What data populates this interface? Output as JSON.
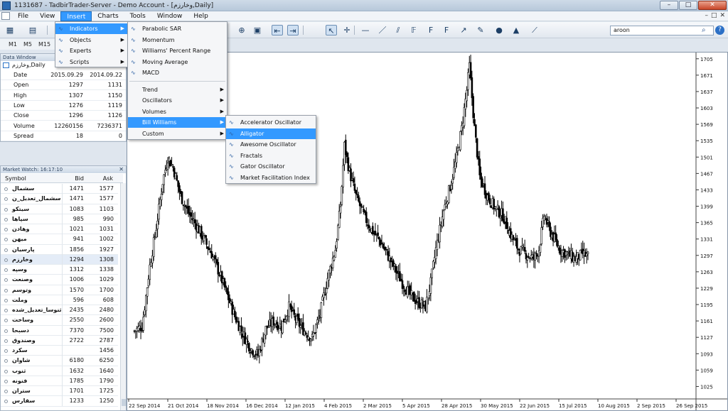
{
  "window": {
    "title": "1131687 - TadbirTrader-Server - Demo Account - [وخارزم,Daily]",
    "controls": [
      "–",
      "□",
      "✕"
    ]
  },
  "menubar": {
    "items": [
      "File",
      "View",
      "Insert",
      "Charts",
      "Tools",
      "Window",
      "Help"
    ],
    "active": "Insert",
    "mdi_controls": [
      "–",
      "□",
      "✕"
    ]
  },
  "toolbar": {
    "search_value": "aroon"
  },
  "timeframes": [
    "M1",
    "M5",
    "M15"
  ],
  "data_window": {
    "title": "Data Window",
    "symbol": "وخارزم,Daily",
    "rows": [
      {
        "label": "Date",
        "v1": "2015.09.29",
        "v2": "2014.09.22"
      },
      {
        "label": "Open",
        "v1": "1297",
        "v2": "1131"
      },
      {
        "label": "High",
        "v1": "1307",
        "v2": "1150"
      },
      {
        "label": "Low",
        "v1": "1276",
        "v2": "1119"
      },
      {
        "label": "Close",
        "v1": "1296",
        "v2": "1126"
      },
      {
        "label": "Volume",
        "v1": "12260156",
        "v2": "7236371"
      },
      {
        "label": "Spread",
        "v1": "18",
        "v2": "0"
      }
    ]
  },
  "market_watch": {
    "title": "Market Watch: 16:17:10",
    "columns": [
      "Symbol",
      "Bid",
      "Ask"
    ],
    "rows": [
      {
        "symbol": "سشمال",
        "bid": "1471",
        "ask": "1577"
      },
      {
        "symbol": "سشمال_تعدیل_ن",
        "bid": "1471",
        "ask": "1577"
      },
      {
        "symbol": "سیتکو",
        "bid": "1083",
        "ask": "1103"
      },
      {
        "symbol": "سپاها",
        "bid": "985",
        "ask": "990"
      },
      {
        "symbol": "وهادن",
        "bid": "1021",
        "ask": "1031"
      },
      {
        "symbol": "میهن",
        "bid": "941",
        "ask": "1002"
      },
      {
        "symbol": "پارسیان",
        "bid": "1856",
        "ask": "1927"
      },
      {
        "symbol": "وخارزم",
        "bid": "1294",
        "ask": "1308"
      },
      {
        "symbol": "وسپه",
        "bid": "1312",
        "ask": "1338"
      },
      {
        "symbol": "وصنعت",
        "bid": "1006",
        "ask": "1029"
      },
      {
        "symbol": "وتوسم",
        "bid": "1570",
        "ask": "1700"
      },
      {
        "symbol": "وملت",
        "bid": "596",
        "ask": "608"
      },
      {
        "symbol": "ثنوسا_تعدیل_شده",
        "bid": "2435",
        "ask": "2480"
      },
      {
        "symbol": "وساخت",
        "bid": "2550",
        "ask": "2600"
      },
      {
        "symbol": "دسبحا",
        "bid": "7370",
        "ask": "7500"
      },
      {
        "symbol": "وصندوق",
        "bid": "2722",
        "ask": "2787"
      },
      {
        "symbol": "سکرد",
        "bid": "",
        "ask": "1456"
      },
      {
        "symbol": "شاوان",
        "bid": "6180",
        "ask": "6250"
      },
      {
        "symbol": "ثنوب",
        "bid": "1632",
        "ask": "1640"
      },
      {
        "symbol": "فنونه",
        "bid": "1785",
        "ask": "1790"
      },
      {
        "symbol": "ستران",
        "bid": "1701",
        "ask": "1725"
      },
      {
        "symbol": "سفارس",
        "bid": "1233",
        "ask": "1250"
      }
    ]
  },
  "insert_menu": {
    "items": [
      {
        "label": "Indicators",
        "submenu": true
      },
      {
        "label": "Objects",
        "submenu": true
      },
      {
        "label": "Experts",
        "submenu": true
      },
      {
        "label": "Scripts",
        "submenu": true
      }
    ],
    "highlighted": "Indicators"
  },
  "indicators_menu": {
    "items": [
      {
        "label": "Parabolic SAR",
        "submenu": false
      },
      {
        "label": "Momentum",
        "submenu": false
      },
      {
        "label": "Williams' Percent Range",
        "submenu": false
      },
      {
        "label": "Moving Average",
        "submenu": false
      },
      {
        "label": "MACD",
        "submenu": false
      },
      {
        "label": "Trend",
        "submenu": true
      },
      {
        "label": "Oscillators",
        "submenu": true
      },
      {
        "label": "Volumes",
        "submenu": true
      },
      {
        "label": "Bill Williams",
        "submenu": true
      },
      {
        "label": "Custom",
        "submenu": true
      }
    ],
    "highlighted": "Bill Williams"
  },
  "bill_williams_menu": {
    "items": [
      "Accelerator Oscillator",
      "Alligator",
      "Awesome Oscillator",
      "Fractals",
      "Gator Oscillator",
      "Market Facilitation Index"
    ],
    "highlighted": "Alligator"
  },
  "chart_data": {
    "type": "bar",
    "title": "",
    "symbol": "وخارزم",
    "timeframe": "Daily",
    "y_ticks": [
      "1705",
      "1671",
      "1637",
      "1603",
      "1569",
      "1535",
      "1501",
      "1467",
      "1433",
      "1399",
      "1365",
      "1331",
      "1297",
      "1263",
      "1229",
      "1195",
      "1161",
      "1127",
      "1093",
      "1059",
      "1025"
    ],
    "x_ticks": [
      "22 Sep 2014",
      "21 Oct 2014",
      "18 Nov 2014",
      "16 Dec 2014",
      "12 Jan 2015",
      "4 Feb 2015",
      "2 Mar 2015",
      "5 Apr 2015",
      "28 Apr 2015",
      "30 May 2015",
      "22 Jun 2015",
      "15 Jul 2015",
      "10 Aug 2015",
      "2 Sep 2015",
      "26 Sep 2015"
    ],
    "ylim": [
      1008,
      1715
    ],
    "price_path": [
      [
        0,
        1140
      ],
      [
        6,
        1150
      ],
      [
        12,
        1275
      ],
      [
        17,
        1355
      ],
      [
        22,
        1450
      ],
      [
        26,
        1500
      ],
      [
        30,
        1480
      ],
      [
        36,
        1420
      ],
      [
        42,
        1385
      ],
      [
        48,
        1360
      ],
      [
        54,
        1330
      ],
      [
        60,
        1300
      ],
      [
        66,
        1260
      ],
      [
        72,
        1215
      ],
      [
        78,
        1170
      ],
      [
        84,
        1135
      ],
      [
        90,
        1105
      ],
      [
        96,
        1090
      ],
      [
        102,
        1145
      ],
      [
        108,
        1160
      ],
      [
        114,
        1150
      ],
      [
        120,
        1190
      ],
      [
        126,
        1160
      ],
      [
        132,
        1140
      ],
      [
        138,
        1125
      ],
      [
        144,
        1175
      ],
      [
        150,
        1250
      ],
      [
        156,
        1310
      ],
      [
        160,
        1400
      ],
      [
        163,
        1525
      ],
      [
        167,
        1470
      ],
      [
        172,
        1420
      ],
      [
        178,
        1380
      ],
      [
        184,
        1350
      ],
      [
        190,
        1330
      ],
      [
        196,
        1300
      ],
      [
        202,
        1270
      ],
      [
        208,
        1240
      ],
      [
        214,
        1215
      ],
      [
        220,
        1200
      ],
      [
        226,
        1190
      ],
      [
        230,
        1240
      ],
      [
        234,
        1310
      ],
      [
        240,
        1390
      ],
      [
        246,
        1450
      ],
      [
        250,
        1500
      ],
      [
        254,
        1560
      ],
      [
        258,
        1640
      ],
      [
        260,
        1690
      ],
      [
        264,
        1560
      ],
      [
        268,
        1460
      ],
      [
        274,
        1420
      ],
      [
        280,
        1395
      ],
      [
        286,
        1380
      ],
      [
        292,
        1340
      ],
      [
        298,
        1310
      ],
      [
        304,
        1300
      ],
      [
        310,
        1290
      ],
      [
        314,
        1310
      ],
      [
        318,
        1380
      ],
      [
        322,
        1350
      ],
      [
        326,
        1330
      ],
      [
        330,
        1310
      ],
      [
        336,
        1300
      ],
      [
        342,
        1290
      ],
      [
        348,
        1300
      ],
      [
        352,
        1295
      ]
    ]
  }
}
